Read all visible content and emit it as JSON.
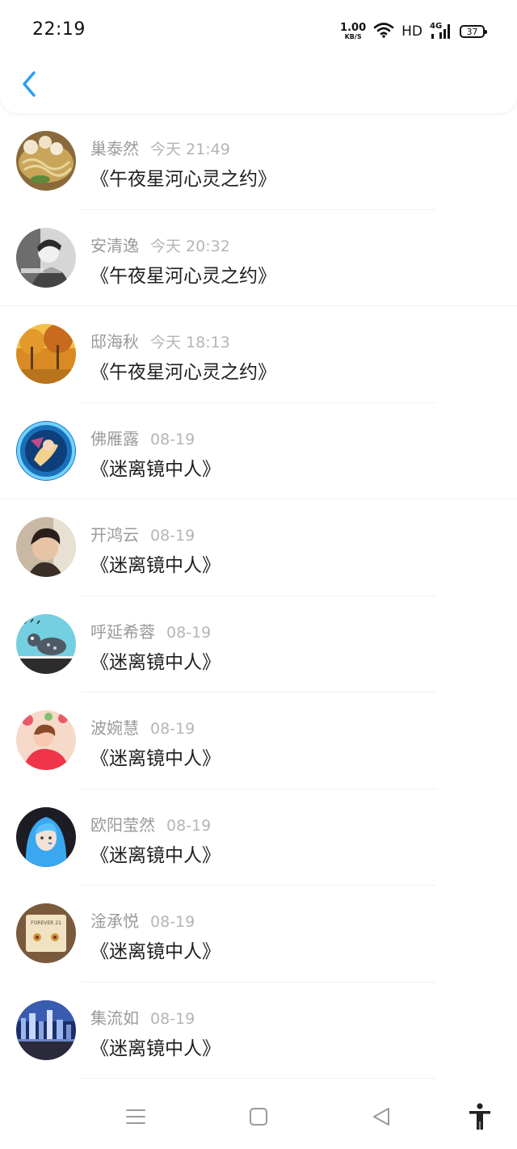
{
  "status_bar": {
    "time": "22:19",
    "net_speed_value": "1.00",
    "net_speed_unit": "KB/S",
    "hd_label": "HD",
    "network_label": "4G",
    "battery_level": "37"
  },
  "messages": [
    {
      "name": "巢泰然",
      "time": "今天 21:49",
      "title": "《午夜星河心灵之约》"
    },
    {
      "name": "安清逸",
      "time": "今天 20:32",
      "title": "《午夜星河心灵之约》"
    },
    {
      "name": "邸海秋",
      "time": "今天 18:13",
      "title": "《午夜星河心灵之约》"
    },
    {
      "name": "佛雁露",
      "time": "08-19",
      "title": "《迷离镜中人》"
    },
    {
      "name": "开鸿云",
      "time": "08-19",
      "title": "《迷离镜中人》"
    },
    {
      "name": "呼延希蓉",
      "time": "08-19",
      "title": "《迷离镜中人》"
    },
    {
      "name": "波婉慧",
      "time": "08-19",
      "title": "《迷离镜中人》"
    },
    {
      "name": "欧阳莹然",
      "time": "08-19",
      "title": "《迷离镜中人》"
    },
    {
      "name": "淦承悦",
      "time": "08-19",
      "title": "《迷离镜中人》"
    },
    {
      "name": "集流如",
      "time": "08-19",
      "title": "《迷离镜中人》"
    }
  ],
  "avatar_stickers": {
    "item_9_sticker": "FOREVER 21"
  },
  "colors": {
    "accent": "#2a9df4",
    "name_gray": "#9a9a9a",
    "title_dark": "#1f1f1f"
  },
  "icons": {
    "back": "chevron-left-icon",
    "nav_menu": "menu-icon",
    "nav_home": "square-home-icon",
    "nav_back": "triangle-back-icon",
    "accessibility": "accessibility-icon"
  }
}
